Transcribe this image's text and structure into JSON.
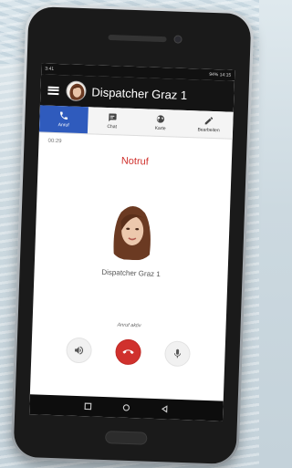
{
  "status_bar": {
    "left": "3:41",
    "right": "94% 14:15"
  },
  "app_bar": {
    "title": "Dispatcher Graz 1"
  },
  "tabs": [
    {
      "label": "Anruf",
      "icon": "phone-icon",
      "active": true
    },
    {
      "label": "Chat",
      "icon": "chat-icon",
      "active": false
    },
    {
      "label": "Karte",
      "icon": "globe-icon",
      "active": false
    },
    {
      "label": "Bearbeiten",
      "icon": "pencil-icon",
      "active": false
    }
  ],
  "call": {
    "timer": "00:29",
    "type": "Notruf",
    "caller_name": "Dispatcher Graz 1",
    "status": "Anruf aktiv"
  },
  "controls": {
    "speaker_icon": "speaker-icon",
    "hangup_icon": "hangup-icon",
    "mic_icon": "microphone-icon"
  },
  "colors": {
    "accent": "#2f5bbd",
    "alert": "#d0312d",
    "appbar": "#141414"
  }
}
